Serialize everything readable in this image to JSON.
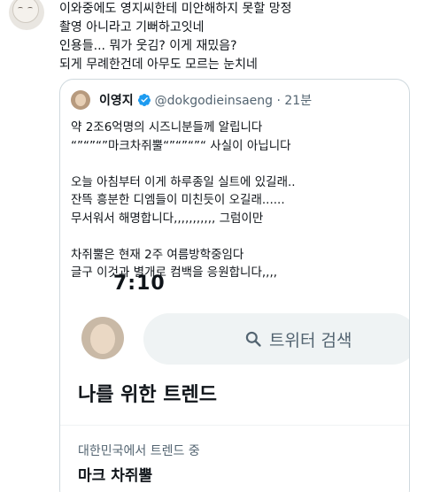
{
  "reply": {
    "lines": [
      "이와중에도 영지씨한테 미안해하지 못할 망정",
      "촬영 아니라고 기뻐하고잇네",
      "인용들... 뭐가 웃김? 이게 재밌음?",
      "되게 무례한건데 아무도 모르는 눈치네"
    ]
  },
  "quoted_tweet": {
    "author_name": "이영지",
    "handle_and_time": "@dokgodieinsaeng · 21분",
    "lines": [
      "약 2조6억명의 시즈니분들께 알립니다",
      "“”“”“”마크차쥐뿔“”“”“”“ 사실이 아닙니다",
      "",
      "오늘 아침부터 이게 하루종일 실트에 있길래..",
      "잔뜩 흥분한 디엠들이 미친듯이 오길래......",
      "무서워서 해명합니다,,,,,,,,,,, 그럼이만",
      "",
      "차쥐뿔은 현재 2주 여름방학중임다",
      "글구 이것과 별개로 컴백을 응원합니다,,,,"
    ],
    "screenshot": {
      "time": "7:10",
      "search_placeholder": "트위터 검색",
      "trends_title": "나를 위한 트렌드",
      "trend_context": "대한민국에서 트렌드 중",
      "trend_name": "마크 차쥐뿔"
    }
  },
  "colors": {
    "text": "#0f1419",
    "secondary_text": "#536471",
    "verified_blue": "#1d9bf0",
    "border": "#cfd9de",
    "search_bg": "#eff3f4"
  },
  "icons": {
    "verified": "verified-badge-icon",
    "search": "search-icon"
  }
}
